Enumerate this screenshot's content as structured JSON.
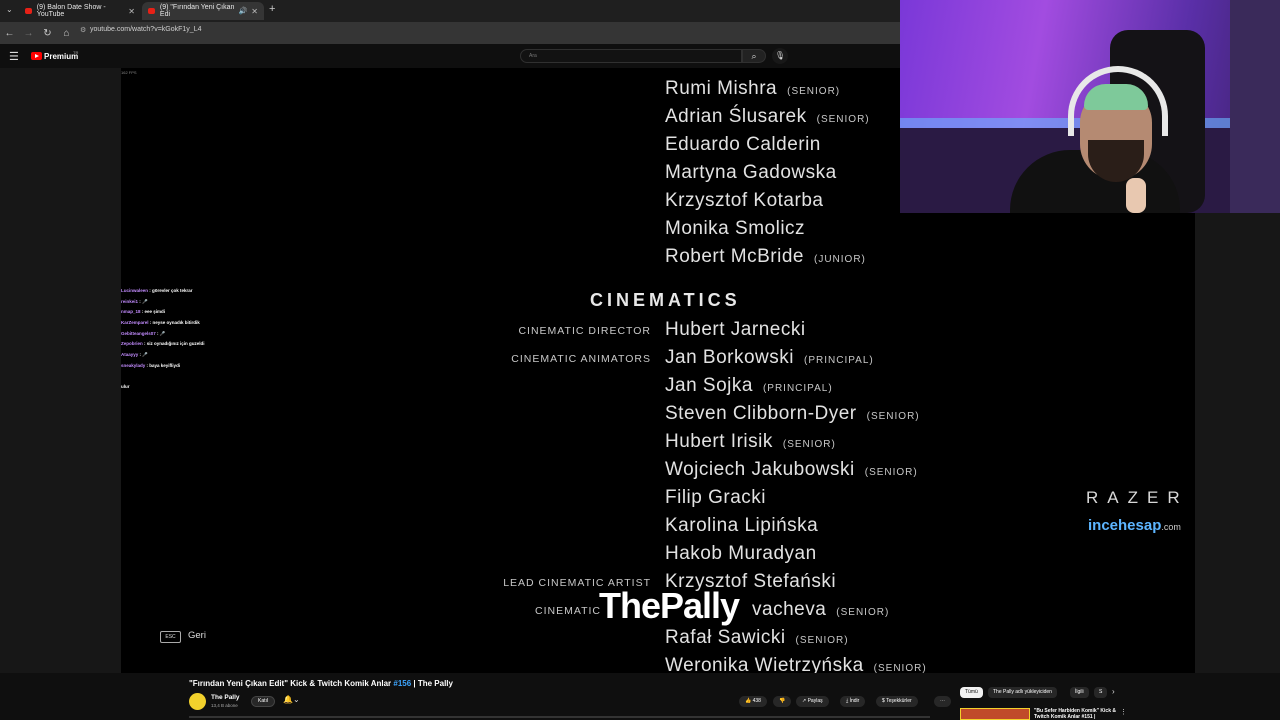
{
  "browser": {
    "tabs": [
      {
        "label": "(9) Balon Date Show - YouTube",
        "active": false
      },
      {
        "label": "(9) \"Fırından Yeni Çıkan Edi",
        "active": true
      }
    ],
    "new_tab": "+",
    "url": "youtube.com/watch?v=kGokF1y_L4"
  },
  "youtube_header": {
    "logo_label": "Premium",
    "logo_sup": "TR",
    "search_placeholder": "Ara"
  },
  "stream_overlay": {
    "fps_text": "162 FPS",
    "chat": [
      {
        "user": "Lucinwaleen",
        "msg": ": görevler çok tekrar"
      },
      {
        "user": "reinkei1",
        "msg": ": 🎤"
      },
      {
        "user": "nmap_18",
        "msg": ": eee şimdi"
      },
      {
        "user": "KarZemparel",
        "msg": ": neyse oynadık bitirdik"
      },
      {
        "user": "Gebitteangels07",
        "msg": ": 🎤"
      },
      {
        "user": "Zepobrien",
        "msg": ": siz oynadığınız için guzeldi"
      },
      {
        "user": "Ataayyy",
        "msg": ": 🎤"
      },
      {
        "user": "sneakylady",
        "msg": ": baya keyifliydi"
      },
      {
        "user": "",
        "msg": ""
      },
      {
        "user": "",
        "msg": "ulur"
      }
    ],
    "watermark": "ThePally",
    "sponsor_1": "RAZER",
    "sponsor_2_main": "incehesap",
    "sponsor_2_tld": ".com",
    "esc_key": "ESC",
    "esc_label": "Geri"
  },
  "credits": {
    "section_title": "CINEMATICS",
    "names": [
      {
        "name": "Rumi Mishra",
        "tag": "(SENIOR)",
        "role": ""
      },
      {
        "name": "Adrian Ślusarek",
        "tag": "(SENIOR)",
        "role": ""
      },
      {
        "name": "Eduardo Calderin",
        "tag": "",
        "role": ""
      },
      {
        "name": "Martyna Gadowska",
        "tag": "",
        "role": ""
      },
      {
        "name": "Krzysztof Kotarba",
        "tag": "",
        "role": ""
      },
      {
        "name": "Monika Smolicz",
        "tag": "",
        "role": ""
      },
      {
        "name": "Robert McBride",
        "tag": "(JUNIOR)",
        "role": ""
      },
      {
        "name": "Hubert Jarnecki",
        "tag": "",
        "role": "CINEMATIC DIRECTOR"
      },
      {
        "name": "Jan Borkowski",
        "tag": "(PRINCIPAL)",
        "role": "CINEMATIC ANIMATORS"
      },
      {
        "name": "Jan Sojka",
        "tag": "(PRINCIPAL)",
        "role": ""
      },
      {
        "name": "Steven Clibborn-Dyer",
        "tag": "(SENIOR)",
        "role": ""
      },
      {
        "name": "Hubert Irisik",
        "tag": "(SENIOR)",
        "role": ""
      },
      {
        "name": "Wojciech Jakubowski",
        "tag": "(SENIOR)",
        "role": ""
      },
      {
        "name": "Filip Gracki",
        "tag": "",
        "role": ""
      },
      {
        "name": "Karolina Lipińska",
        "tag": "",
        "role": ""
      },
      {
        "name": "Hakob Muradyan",
        "tag": "",
        "role": ""
      },
      {
        "name": "Krzysztof Stefański",
        "tag": "",
        "role": "LEAD CINEMATIC ARTIST"
      },
      {
        "name": "vacheva",
        "tag": "(SENIOR)",
        "role": "CINEMATIC"
      },
      {
        "name": "Rafał Sawicki",
        "tag": "(SENIOR)",
        "role": ""
      },
      {
        "name": "Weronika Wietrzyńska",
        "tag": "(SENIOR)",
        "role": ""
      }
    ]
  },
  "video_info": {
    "title_prefix": "\"Fırından Yeni Çıkan Edit\" Kick & Twitch Komik Anlar ",
    "title_hash": "#156",
    "title_suffix": " | The Pally",
    "channel_name": "The Pally",
    "subscribers": "13,4 B abone",
    "join_label": "Katıl",
    "actions": {
      "likes": "438",
      "share": "Paylaş",
      "download": "İndir",
      "thanks": "Teşekkürler",
      "more": "⋯"
    }
  },
  "recommendations": {
    "chips": [
      "Tümü",
      "The Pally adlı yükleyiciden",
      "İlgili",
      "S"
    ],
    "first_title": "\"Bu Sefer Harbiden Komik\" Kick & Twitch Komik Anlar #151 |"
  },
  "colors": {
    "accent_red": "#ff0000",
    "link_blue": "#3ea6ff",
    "avatar_yellow": "#f2d12c",
    "webcam_purple": "#a24ce0"
  }
}
